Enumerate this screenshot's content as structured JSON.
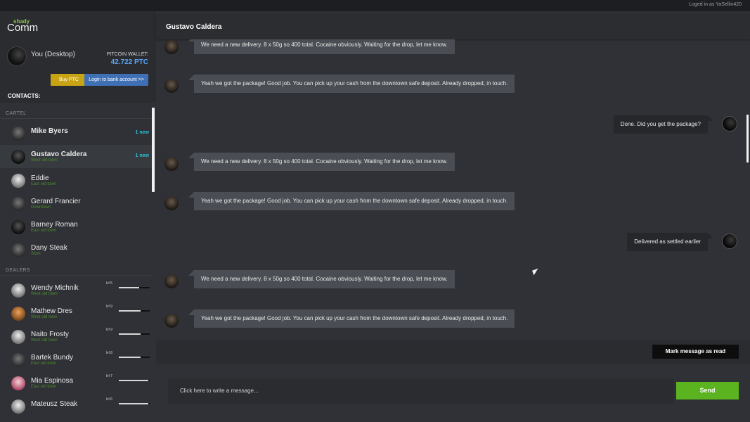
{
  "topbar": {
    "login_text": "Loged in as YaSellin420"
  },
  "logo": {
    "shady": "shady",
    "comm": "Comm"
  },
  "profile": {
    "name": "You (Desktop)",
    "wallet_label": "PITCOIN WALLET:",
    "wallet_value": "42.722 PTC",
    "buy_label": "Buy PTC",
    "bank_label": "Login to bank account >>"
  },
  "contacts_label": "CONTACTS:",
  "sections": {
    "cartel": "CARTEL",
    "dealers": "DEALERS"
  },
  "cartel": [
    {
      "name": "Mike Byers",
      "location": "",
      "badge": "1 new"
    },
    {
      "name": "Gustavo Caldera",
      "location": "West old town",
      "badge": "1 new"
    },
    {
      "name": "Eddie",
      "location": "East old town",
      "badge": ""
    },
    {
      "name": "Gerard Francier",
      "location": "Downtown",
      "badge": ""
    },
    {
      "name": "Barney Roman",
      "location": "East old town",
      "badge": ""
    },
    {
      "name": "Dany Steak",
      "location": "Slum",
      "badge": ""
    }
  ],
  "dealers": [
    {
      "name": "Wendy Michnik",
      "location": "West old town",
      "level": "lvl 5",
      "progress": 0.65
    },
    {
      "name": "Mathew Dres",
      "location": "West old town",
      "level": "lvl 9",
      "progress": 0.7
    },
    {
      "name": "Naito Frosty",
      "location": "West old town",
      "level": "lvl 9",
      "progress": 0.7
    },
    {
      "name": "Bartek Bundy",
      "location": "East old town",
      "level": "lvl 8",
      "progress": 0.7
    },
    {
      "name": "Mia Espinosa",
      "location": "East old town",
      "level": "lvl 7",
      "progress": 0.95
    },
    {
      "name": "Mateusz Steak",
      "location": "",
      "level": "lvl 6",
      "progress": 0.95
    }
  ],
  "chat": {
    "title": "Gustavo Caldera",
    "messages": [
      {
        "dir": "in",
        "text": "We need a new delivery. 8 x 50g so 400 total. Cocaine obviously. Waiting for the drop, let me know."
      },
      {
        "dir": "in",
        "text": "Yeah we got the package! Good job. You can pick up your cash from the downtown safe deposit. Already dropped, in touch."
      },
      {
        "dir": "out",
        "text": "Done. Did you get the package?"
      },
      {
        "dir": "in",
        "text": "We need a new delivery. 8 x 50g so 400 total. Cocaine obviously. Waiting for the drop, let me know."
      },
      {
        "dir": "in",
        "text": "Yeah we got the package! Good job. You can pick up your cash from the downtown safe deposit. Already dropped, in touch."
      },
      {
        "dir": "out",
        "text": "Delivered as settled earlier"
      },
      {
        "dir": "in",
        "text": "We need a new delivery. 8 x 50g so 400 total. Cocaine obviously. Waiting for the drop, let me know."
      },
      {
        "dir": "in",
        "text": "Yeah we got the package! Good job. You can pick up your cash from the downtown safe deposit. Already dropped, in touch."
      }
    ],
    "mark_read_label": "Mark message as read",
    "compose_placeholder": "Click here to write a message...",
    "send_label": "Send"
  },
  "colors": {
    "accent_green": "#5ab31f",
    "accent_blue": "#58a6ff",
    "new_badge": "#29c3d9",
    "buy_btn": "#c8a414",
    "bank_btn": "#3f6fb4"
  }
}
